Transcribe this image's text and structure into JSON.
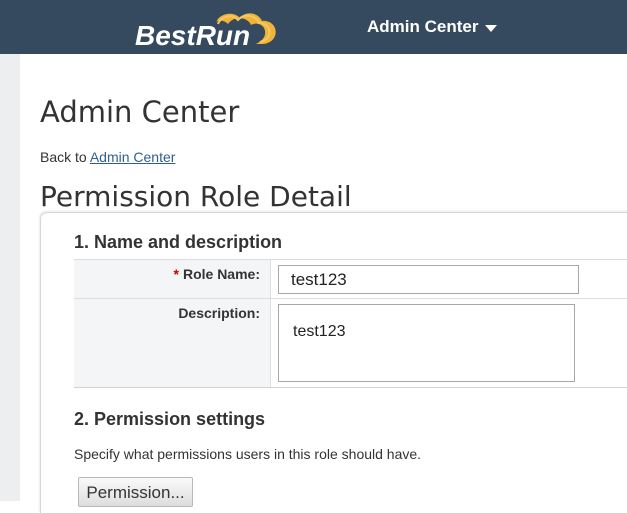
{
  "header": {
    "brand": "BestRun",
    "admin_menu_label": "Admin Center",
    "caret_icon": "caret-down-icon",
    "background_color": "#354a5f"
  },
  "main": {
    "page_title": "Admin Center",
    "back_prefix": "Back to",
    "back_link": "Admin Center",
    "detail_title": "Permission Role Detail",
    "sections": [
      {
        "heading": "1. Name and description",
        "fields": {
          "role_name": {
            "label": "Role Name:",
            "required_marker": "*",
            "value": "test123"
          },
          "description": {
            "label": "Description:",
            "value": "test123"
          }
        }
      },
      {
        "heading": "2. Permission settings",
        "help_text": "Specify what permissions users in this role should have.",
        "button_label": "Permission..."
      }
    ]
  }
}
